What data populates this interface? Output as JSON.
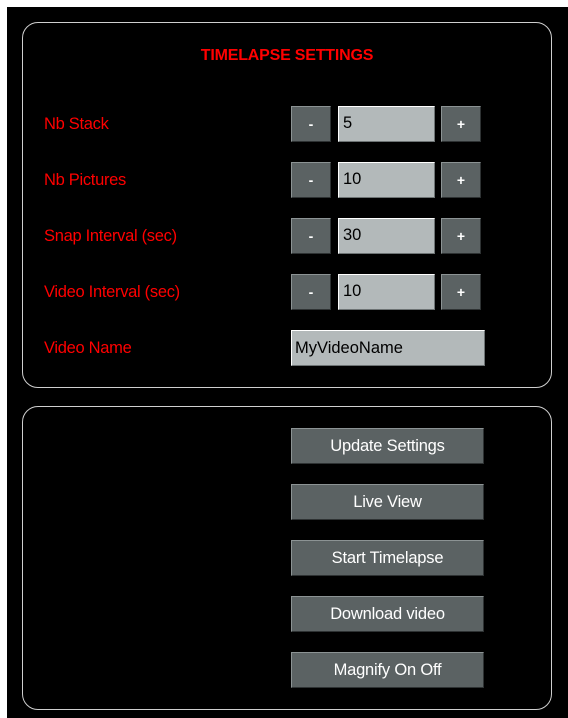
{
  "settings": {
    "title": "TIMELAPSE SETTINGS",
    "stack": {
      "label": "Nb Stack",
      "value": "5",
      "minus": "-",
      "plus": "+"
    },
    "pictures": {
      "label": "Nb Pictures",
      "value": "10",
      "minus": "-",
      "plus": "+"
    },
    "snap_interval": {
      "label": "Snap Interval (sec)",
      "value": "30",
      "minus": "-",
      "plus": "+"
    },
    "video_interval": {
      "label": "Video Interval (sec)",
      "value": "10",
      "minus": "-",
      "plus": "+"
    },
    "video_name": {
      "label": "Video Name",
      "value": "MyVideoName"
    }
  },
  "actions": {
    "update_settings": "Update Settings",
    "live_view": "Live View",
    "start_timelapse": "Start Timelapse",
    "download_video": "Download video",
    "magnify": "Magnify On Off"
  },
  "colors": {
    "background": "#000000",
    "label_red": "#ff0000",
    "button_gray": "#5b6263",
    "input_gray": "#b3b9ba",
    "panel_border": "#cfcfcf"
  }
}
